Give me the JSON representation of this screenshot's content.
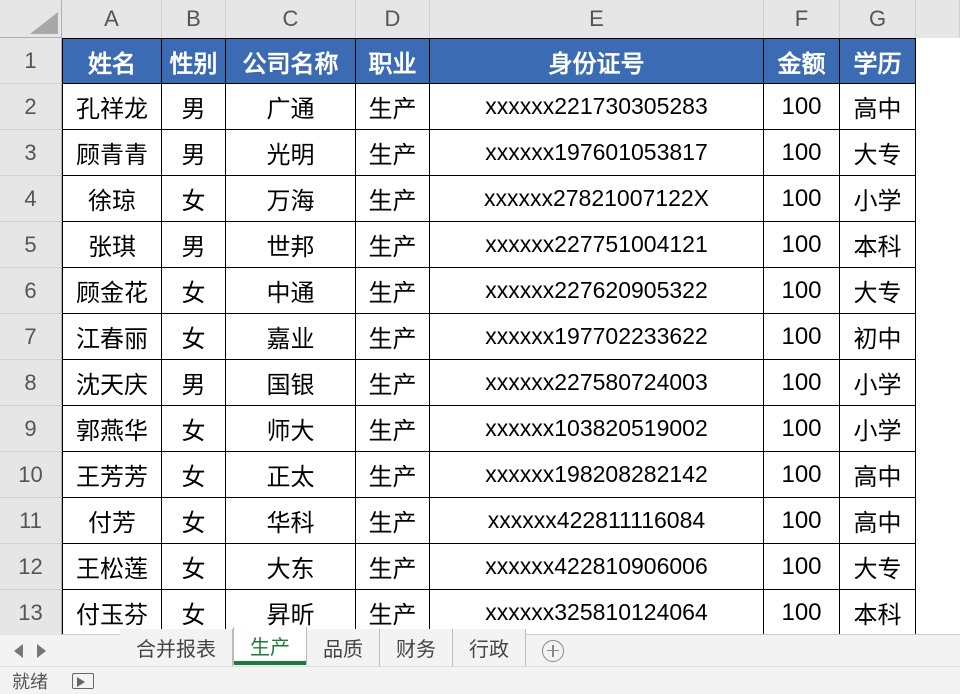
{
  "columns": [
    "A",
    "B",
    "C",
    "D",
    "E",
    "F",
    "G"
  ],
  "rowNumbers": [
    "1",
    "2",
    "3",
    "4",
    "5",
    "6",
    "7",
    "8",
    "9",
    "10",
    "11",
    "12",
    "13"
  ],
  "headers": {
    "name": "姓名",
    "sex": "性别",
    "company": "公司名称",
    "job": "职业",
    "id": "身份证号",
    "amount": "金额",
    "edu": "学历"
  },
  "rows": [
    {
      "name": "孔祥龙",
      "sex": "男",
      "company": "广通",
      "job": "生产",
      "id": "xxxxxx221730305283",
      "amount": "100",
      "edu": "高中"
    },
    {
      "name": "顾青青",
      "sex": "男",
      "company": "光明",
      "job": "生产",
      "id": "xxxxxx197601053817",
      "amount": "100",
      "edu": "大专"
    },
    {
      "name": "徐琼",
      "sex": "女",
      "company": "万海",
      "job": "生产",
      "id": "xxxxxx27821007122X",
      "amount": "100",
      "edu": "小学"
    },
    {
      "name": "张琪",
      "sex": "男",
      "company": "世邦",
      "job": "生产",
      "id": "xxxxxx227751004121",
      "amount": "100",
      "edu": "本科"
    },
    {
      "name": "顾金花",
      "sex": "女",
      "company": "中通",
      "job": "生产",
      "id": "xxxxxx227620905322",
      "amount": "100",
      "edu": "大专"
    },
    {
      "name": "江春丽",
      "sex": "女",
      "company": "嘉业",
      "job": "生产",
      "id": "xxxxxx197702233622",
      "amount": "100",
      "edu": "初中"
    },
    {
      "name": "沈天庆",
      "sex": "男",
      "company": "国银",
      "job": "生产",
      "id": "xxxxxx227580724003",
      "amount": "100",
      "edu": "小学"
    },
    {
      "name": "郭燕华",
      "sex": "女",
      "company": "师大",
      "job": "生产",
      "id": "xxxxxx103820519002",
      "amount": "100",
      "edu": "小学"
    },
    {
      "name": "王芳芳",
      "sex": "女",
      "company": "正太",
      "job": "生产",
      "id": "xxxxxx198208282142",
      "amount": "100",
      "edu": "高中"
    },
    {
      "name": "付芳",
      "sex": "女",
      "company": "华科",
      "job": "生产",
      "id": "xxxxxx422811116084",
      "amount": "100",
      "edu": "高中"
    },
    {
      "name": "王松莲",
      "sex": "女",
      "company": "大东",
      "job": "生产",
      "id": "xxxxxx422810906006",
      "amount": "100",
      "edu": "大专"
    },
    {
      "name": "付玉芬",
      "sex": "女",
      "company": "昇昕",
      "job": "生产",
      "id": "xxxxxx325810124064",
      "amount": "100",
      "edu": "本科"
    }
  ],
  "tabs": [
    "合并报表",
    "生产",
    "品质",
    "财务",
    "行政"
  ],
  "activeTab": "生产",
  "status": "就绪"
}
